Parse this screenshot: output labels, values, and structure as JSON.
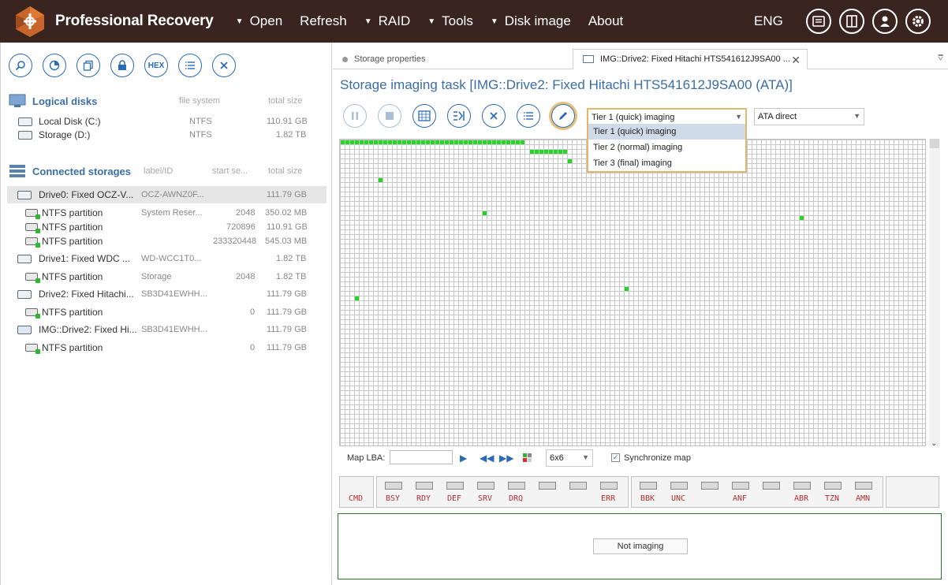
{
  "app": {
    "title": "Professional Recovery",
    "accent": "#2a6ab8",
    "topbar_color": "#3a2420"
  },
  "menu": [
    {
      "label": "Open",
      "has_caret": true
    },
    {
      "label": "Refresh",
      "has_caret": false
    },
    {
      "label": "RAID",
      "has_caret": true
    },
    {
      "label": "Tools",
      "has_caret": true
    },
    {
      "label": "Disk image",
      "has_caret": true
    },
    {
      "label": "About",
      "has_caret": false
    }
  ],
  "lang": "ENG",
  "top_icons": [
    "messages-icon",
    "panel-icon",
    "user-icon",
    "settings-icon"
  ],
  "left_toolbar": {
    "buttons": [
      "search-icon",
      "chart-icon",
      "copy-icon",
      "lock-icon",
      "hex-icon",
      "list-icon",
      "close-icon"
    ],
    "hex_label": "HEX"
  },
  "logical_disks": {
    "title": "Logical disks",
    "col_fs": "file system",
    "col_size": "total size",
    "items": [
      {
        "name": "Local Disk (C:)",
        "fs": "NTFS",
        "size": "110.91 GB"
      },
      {
        "name": "Storage (D:)",
        "fs": "NTFS",
        "size": "1.82 TB"
      }
    ]
  },
  "connected": {
    "title": "Connected storages",
    "col_label": "label/ID",
    "col_start": "start se...",
    "col_size": "total size",
    "items": [
      {
        "kind": "drive",
        "name": "Drive0: Fixed OCZ-V...",
        "label": "OCZ-AWNZ0F...",
        "start": "",
        "size": "111.79 GB",
        "selected": true
      },
      {
        "kind": "part",
        "name": "NTFS partition",
        "label": "System Reser...",
        "start": "2048",
        "size": "350.02 MB"
      },
      {
        "kind": "part",
        "name": "NTFS partition",
        "label": "",
        "start": "720896",
        "size": "110.91 GB"
      },
      {
        "kind": "part",
        "name": "NTFS partition",
        "label": "",
        "start": "233320448",
        "size": "545.03 MB"
      },
      {
        "kind": "drive",
        "name": "Drive1: Fixed WDC ...",
        "label": "WD-WCC1T0...",
        "start": "",
        "size": "1.82 TB"
      },
      {
        "kind": "part",
        "name": "NTFS partition",
        "label": "Storage",
        "start": "2048",
        "size": "1.82 TB"
      },
      {
        "kind": "drive",
        "name": "Drive2: Fixed Hitachi...",
        "label": "SB3D41EWHH...",
        "start": "",
        "size": "111.79 GB"
      },
      {
        "kind": "part",
        "name": "NTFS partition",
        "label": "",
        "start": "0",
        "size": "111.79 GB"
      },
      {
        "kind": "drive",
        "name": "IMG::Drive2: Fixed Hi...",
        "label": "SB3D41EWHH...",
        "start": "",
        "size": "111.79 GB"
      },
      {
        "kind": "part",
        "name": "NTFS partition",
        "label": "",
        "start": "0",
        "size": "111.79 GB"
      }
    ]
  },
  "tabs": [
    {
      "label": "Storage properties",
      "active": false
    },
    {
      "label": "IMG::Drive2: Fixed Hitachi HTS541612J9SA00 ...",
      "active": true
    }
  ],
  "task": {
    "title": "Storage imaging task [IMG::Drive2: Fixed Hitachi HTS541612J9SA00 (ATA)]",
    "controls": [
      "pause-icon",
      "stop-icon",
      "map-icon",
      "columns-icon",
      "cancel-icon",
      "list-icon",
      "edit-icon"
    ],
    "tier_select": "Tier 1 (quick) imaging",
    "mode_select": "ATA direct",
    "tier_options": [
      "Tier 1 (quick) imaging",
      "Tier 2 (normal) imaging",
      "Tier 3 (final) imaging"
    ],
    "hovered_option": 0
  },
  "map_controls": {
    "lba_label": "Map LBA:",
    "lba_value": "",
    "block_size": "6x6",
    "sync_label": "Synchronize map",
    "sync_checked": true
  },
  "status": {
    "cmd": "CMD",
    "group1": [
      "BSY",
      "RDY",
      "DEF",
      "SRV",
      "DRQ",
      "",
      "",
      "ERR"
    ],
    "group2": [
      "BBK",
      "UNC",
      "",
      "ANF",
      "",
      "ABR",
      "TZN",
      "AMN"
    ]
  },
  "log": {
    "state": "Not imaging"
  }
}
